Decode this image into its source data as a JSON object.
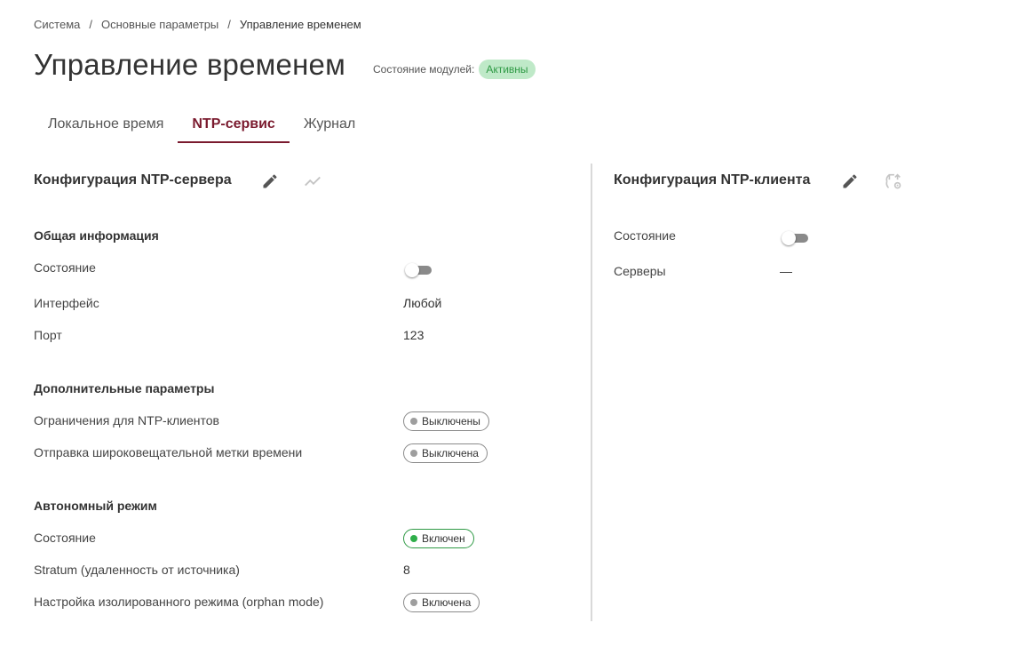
{
  "breadcrumb": {
    "items": [
      "Система",
      "Основные параметры",
      "Управление временем"
    ],
    "separator": "/"
  },
  "page": {
    "title": "Управление временем",
    "module_state_label": "Состояние модулей:",
    "module_state_value": "Активны"
  },
  "tabs": [
    {
      "label": "Локальное время",
      "active": false
    },
    {
      "label": "NTP-сервис",
      "active": true
    },
    {
      "label": "Журнал",
      "active": false
    }
  ],
  "server": {
    "title": "Конфигурация NTP-сервера",
    "icons": [
      "edit-icon",
      "chart-icon"
    ],
    "general": {
      "title": "Общая информация",
      "state_label": "Состояние",
      "state_on": false,
      "interface_label": "Интерфейс",
      "interface_value": "Любой",
      "port_label": "Порт",
      "port_value": "123"
    },
    "extra": {
      "title": "Дополнительные параметры",
      "restrictions_label": "Ограничения для NTP-клиентов",
      "restrictions_value": "Выключены",
      "broadcast_label": "Отправка широковещательной метки времени",
      "broadcast_value": "Выключена"
    },
    "autonomous": {
      "title": "Автономный режим",
      "state_label": "Состояние",
      "state_value": "Включен",
      "stratum_label": "Stratum (удаленность от источника)",
      "stratum_value": "8",
      "orphan_label": "Настройка изолированного режима (orphan mode)",
      "orphan_value": "Включена"
    }
  },
  "client": {
    "title": "Конфигурация NTP-клиента",
    "icons": [
      "edit-icon",
      "sync-settings-icon"
    ],
    "state_label": "Состояние",
    "state_on": false,
    "servers_label": "Серверы",
    "servers_value": "—"
  },
  "colors": {
    "accent": "#7a1a2e",
    "active_badge_bg": "#bfe9c8",
    "active_badge_text": "#2f9a45",
    "on_dot": "#2fae4a",
    "off_dot": "#9e9e9e"
  }
}
